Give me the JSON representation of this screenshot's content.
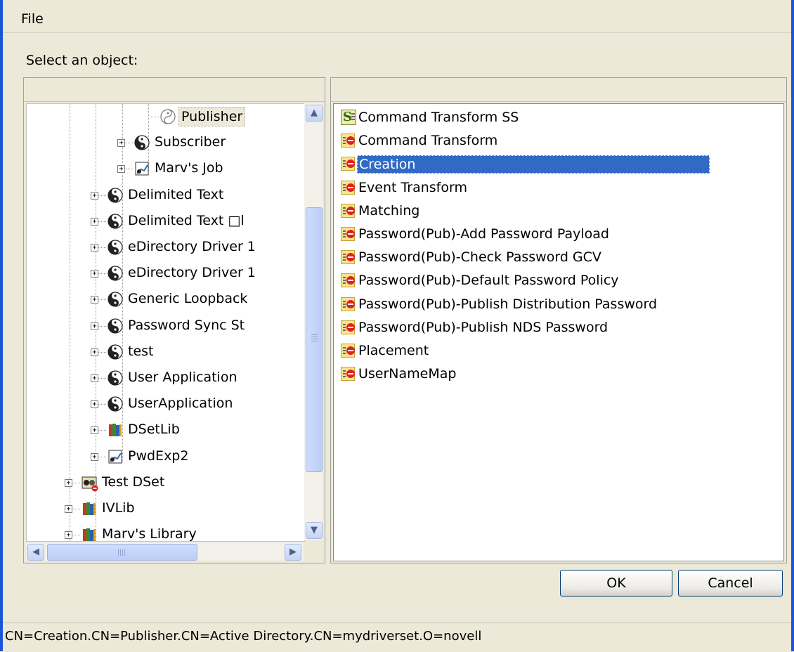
{
  "menu": {
    "file_label": "File"
  },
  "prompt": "Select an object:",
  "tree": {
    "items": [
      {
        "label": "Publisher",
        "icon": "yin-yang-outline-icon",
        "selected": true
      },
      {
        "label": "Subscriber",
        "icon": "yin-yang-icon"
      },
      {
        "label": "Marv's Job",
        "icon": "job-icon"
      },
      {
        "label": "Delimited Text",
        "icon": "yin-yang-icon"
      },
      {
        "label": "Delimited Text □l",
        "icon": "yin-yang-icon"
      },
      {
        "label": "eDirectory Driver 1",
        "icon": "yin-yang-icon"
      },
      {
        "label": "eDirectory Driver 1",
        "icon": "yin-yang-icon"
      },
      {
        "label": "Generic Loopback",
        "icon": "yin-yang-icon"
      },
      {
        "label": "Password Sync St",
        "icon": "yin-yang-icon"
      },
      {
        "label": "test",
        "icon": "yin-yang-icon"
      },
      {
        "label": "User Application",
        "icon": "yin-yang-icon"
      },
      {
        "label": "UserApplication",
        "icon": "yin-yang-icon"
      },
      {
        "label": "DSetLib",
        "icon": "library-books-icon"
      },
      {
        "label": "PwdExp2",
        "icon": "job-icon"
      },
      {
        "label": "Test DSet",
        "icon": "driver-set-icon"
      },
      {
        "label": "IVLib",
        "icon": "library-books-icon"
      },
      {
        "label": "Marv's Library",
        "icon": "library-books-icon"
      }
    ]
  },
  "list": {
    "items": [
      {
        "label": "Command Transform SS",
        "icon": "stylesheet-icon"
      },
      {
        "label": "Command Transform",
        "icon": "policy-rule-icon"
      },
      {
        "label": "Creation",
        "icon": "policy-rule-icon",
        "selected": true
      },
      {
        "label": "Event Transform",
        "icon": "policy-rule-icon"
      },
      {
        "label": "Matching",
        "icon": "policy-rule-icon"
      },
      {
        "label": "Password(Pub)-Add Password Payload",
        "icon": "policy-rule-icon"
      },
      {
        "label": "Password(Pub)-Check Password GCV",
        "icon": "policy-rule-icon"
      },
      {
        "label": "Password(Pub)-Default Password Policy",
        "icon": "policy-rule-icon"
      },
      {
        "label": "Password(Pub)-Publish Distribution Password",
        "icon": "policy-rule-icon"
      },
      {
        "label": "Password(Pub)-Publish NDS Password",
        "icon": "policy-rule-icon"
      },
      {
        "label": "Placement",
        "icon": "policy-rule-icon"
      },
      {
        "label": "UserNameMap",
        "icon": "policy-rule-icon"
      }
    ]
  },
  "buttons": {
    "ok": "OK",
    "cancel": "Cancel"
  },
  "status": "CN=Creation.CN=Publisher.CN=Active Directory.CN=mydriverset.O=novell",
  "colors": {
    "selection": "#316ac5",
    "frame": "#1c56d8",
    "dialog_bg": "#ece9d8"
  }
}
